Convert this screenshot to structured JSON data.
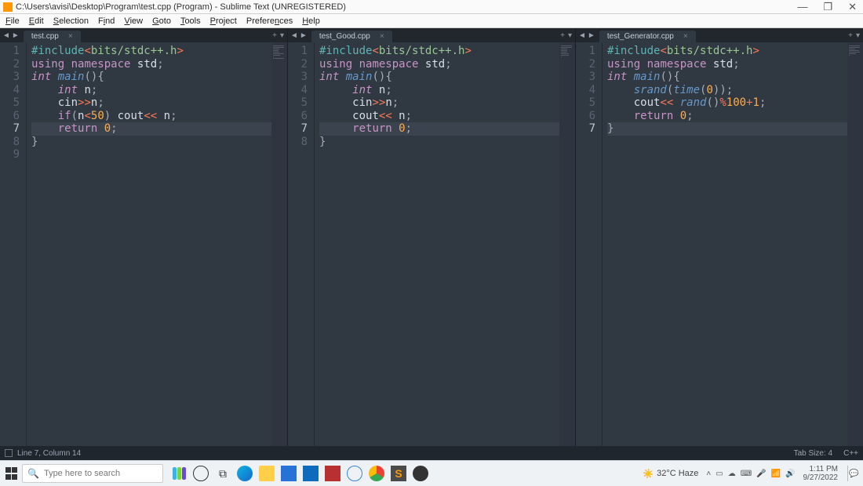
{
  "window": {
    "title": "C:\\Users\\avisi\\Desktop\\Program\\test.cpp (Program) - Sublime Text (UNREGISTERED)",
    "controls": {
      "min": "—",
      "max": "❐",
      "close": "✕"
    }
  },
  "menu": [
    "File",
    "Edit",
    "Selection",
    "Find",
    "View",
    "Goto",
    "Tools",
    "Project",
    "Preferences",
    "Help"
  ],
  "panes": [
    {
      "tab": "test.cpp",
      "active_line": 7,
      "lines": [
        "#include<bits/stdc++.h>",
        "using namespace std;",
        "int main(){",
        "    int n;",
        "    cin>>n;",
        "    if(n<50) cout<< n;",
        "    return 0;",
        "}",
        ""
      ]
    },
    {
      "tab": "test_Good.cpp",
      "active_line": 7,
      "lines": [
        "#include<bits/stdc++.h>",
        "using namespace std;",
        "int main(){",
        "     int n;",
        "     cin>>n;",
        "     cout<< n;",
        "     return 0;",
        "}"
      ]
    },
    {
      "tab": "test_Generator.cpp",
      "active_line": 7,
      "lines": [
        "#include<bits/stdc++.h>",
        "using namespace std;",
        "int main(){",
        "    srand(time(0));",
        "    cout<< rand()%100+1;",
        "    return 0;",
        "}"
      ]
    }
  ],
  "statusbar": {
    "left": "Line 7, Column 14",
    "tab_size": "Tab Size: 4",
    "syntax": "C++"
  },
  "taskbar": {
    "search_placeholder": "Type here to search",
    "weather": "32°C  Haze",
    "time": "1:11 PM",
    "date": "9/27/2022"
  }
}
